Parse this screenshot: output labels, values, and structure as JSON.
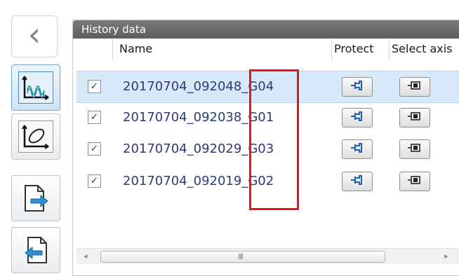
{
  "panel": {
    "title": "History data"
  },
  "columns": {
    "name": "Name",
    "protect": "Protect",
    "select_axis": "Select axis"
  },
  "rows": [
    {
      "name": "20170704_092048_G04",
      "checked": true,
      "selected": true
    },
    {
      "name": "20170704_092038_G01",
      "checked": true,
      "selected": false
    },
    {
      "name": "20170704_092029_G03",
      "checked": true,
      "selected": false
    },
    {
      "name": "20170704_092019_G02",
      "checked": true,
      "selected": false
    }
  ],
  "checkbox_mark": "✓",
  "scrollbar": {
    "left_arrow": "◂",
    "right_arrow": "▸",
    "grip": "III"
  },
  "toolbar": {
    "back_glyph": "‹",
    "icons": [
      "waveform-view-icon",
      "lissajous-view-icon",
      "export-icon",
      "import-icon"
    ]
  },
  "colors": {
    "header_bg": "#6b6b6b",
    "selected_row": "#d7e8f8",
    "highlight": "#e0161d",
    "text_link": "#2b3b7a"
  }
}
